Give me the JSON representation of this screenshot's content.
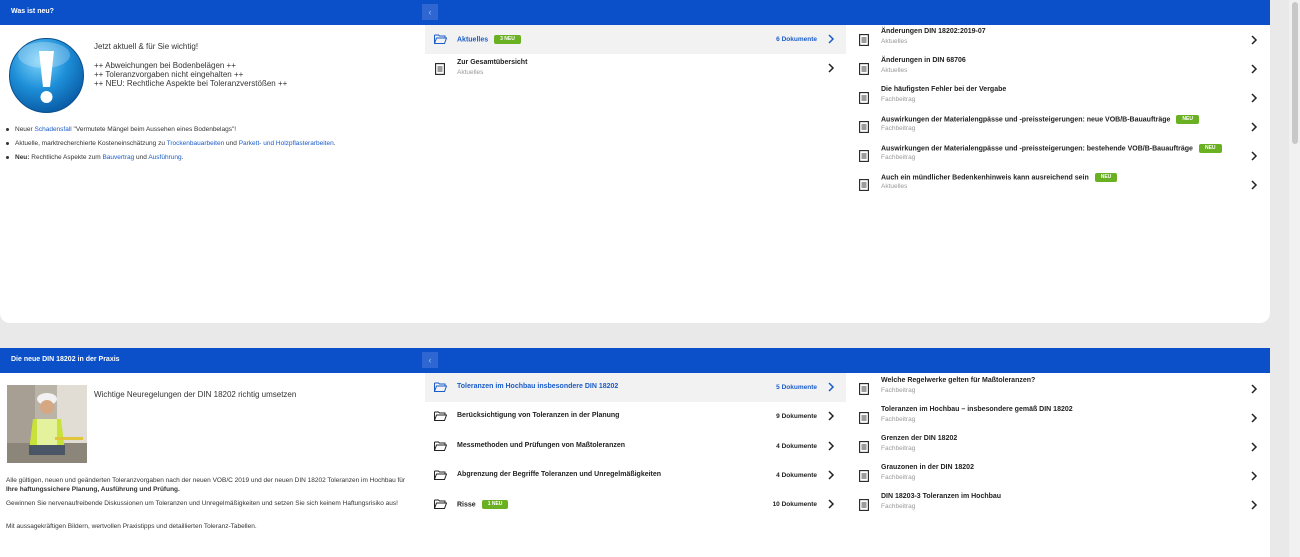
{
  "panel1": {
    "title": "Was ist neu?",
    "intro": {
      "line1": "Jetzt aktuell & für Sie wichtig!",
      "line2": "++ Abweichungen bei Bodenbelägen ++",
      "line3": "++ Toleranzvorgaben nicht eingehalten ++",
      "line4": "++ NEU: Rechtliche Aspekte bei Toleranzverstößen ++"
    },
    "bullets": {
      "b1_pre": "Neuer ",
      "b1_link": "Schadensfall",
      "b1_post": " \"Vermutete Mängel beim Aussehen eines Bodenbelags\"!",
      "b2_pre": "Aktuelle, marktrecherchierte Kosteneinschätzung zu ",
      "b2_link1": "Trockenbauarbeiten",
      "b2_mid": " und ",
      "b2_link2": "Parkett- und Holzpflasterarbeiten",
      "b2_post": ".",
      "b3_bold": "Neu:",
      "b3_pre": " Rechtliche Aspekte zum ",
      "b3_link1": "Bauvertrag",
      "b3_mid": " und ",
      "b3_link2": "Ausführung",
      "b3_post": "."
    },
    "folders": [
      {
        "title": "Aktuelles",
        "badge": "3 NEU",
        "count": "6 Dokumente"
      },
      {
        "title": "Zur Gesamtübersicht",
        "sub": "Aktuelles"
      }
    ],
    "docs": [
      {
        "title": "Änderungen DIN 18202:2019-07",
        "sub": "Aktuelles"
      },
      {
        "title": "Änderungen in DIN 68706",
        "sub": "Aktuelles"
      },
      {
        "title": "Die häufigsten Fehler bei der Vergabe",
        "sub": "Fachbeitrag"
      },
      {
        "title": "Auswirkungen der Materialengpässe und -preissteigerungen: neue VOB/B-Bauaufträge",
        "badge": "NEU",
        "sub": "Fachbeitrag"
      },
      {
        "title": "Auswirkungen der Materialengpässe und -preissteigerungen: bestehende VOB/B-Bauaufträge",
        "badge": "NEU",
        "sub": "Fachbeitrag"
      },
      {
        "title": "Auch ein mündlicher Bedenkenhinweis kann ausreichend sein",
        "badge": "NEU",
        "sub": "Aktuelles"
      }
    ]
  },
  "panel2": {
    "title": "Die neue DIN 18202 in der Praxis",
    "heading": "Wichtige Neuregelungen der DIN 18202 richtig umsetzen",
    "para1_pre": "Alle gültigen, neuen und geänderten Toleranzvorgaben nach der neuen VOB/C 2019 und der neuen DIN 18202 Toleranzen im Hochbau für ",
    "para1_bold": "Ihre haftungssichere Planung, Ausführung und Prüfung.",
    "para2": "Gewinnen Sie nervenaufreibende Diskussionen um Toleranzen und Unregelmäßigkeiten und setzen Sie sich keinem Haftungsrisiko aus!",
    "para3": "Mit aussagekräftigen Bildern, wertvollen Praxistipps und detaillierten Toleranz-Tabellen.",
    "folders": [
      {
        "title": "Toleranzen im Hochbau insbesondere DIN 18202",
        "count": "5 Dokumente"
      },
      {
        "title": "Berücksichtigung von Toleranzen in der Planung",
        "count": "9 Dokumente"
      },
      {
        "title": "Messmethoden und Prüfungen von Maßtoleranzen",
        "count": "4 Dokumente"
      },
      {
        "title": "Abgrenzung der Begriffe Toleranzen und Unregelmäßigkeiten",
        "count": "4 Dokumente"
      },
      {
        "title": "Risse",
        "badge": "1 NEU",
        "count": "10 Dokumente"
      }
    ],
    "docs": [
      {
        "title": "Welche Regelwerke gelten für Maßtoleranzen?",
        "sub": "Fachbeitrag"
      },
      {
        "title": "Toleranzen im Hochbau – insbesondere gemäß DIN 18202",
        "sub": "Fachbeitrag"
      },
      {
        "title": "Grenzen der DIN 18202",
        "sub": "Fachbeitrag"
      },
      {
        "title": "Grauzonen in der DIN 18202",
        "sub": "Fachbeitrag"
      },
      {
        "title": "DIN 18203-3 Toleranzen im Hochbau",
        "sub": "Fachbeitrag"
      }
    ]
  },
  "icons": {
    "back": "‹",
    "alert": "exclamation-icon",
    "folder": "folder-open-icon",
    "document": "document-icon",
    "chevron": "chevron-right-icon"
  },
  "colors": {
    "header": "#0b50c9",
    "link": "#1a5cc8",
    "badge": "#6ab023"
  }
}
